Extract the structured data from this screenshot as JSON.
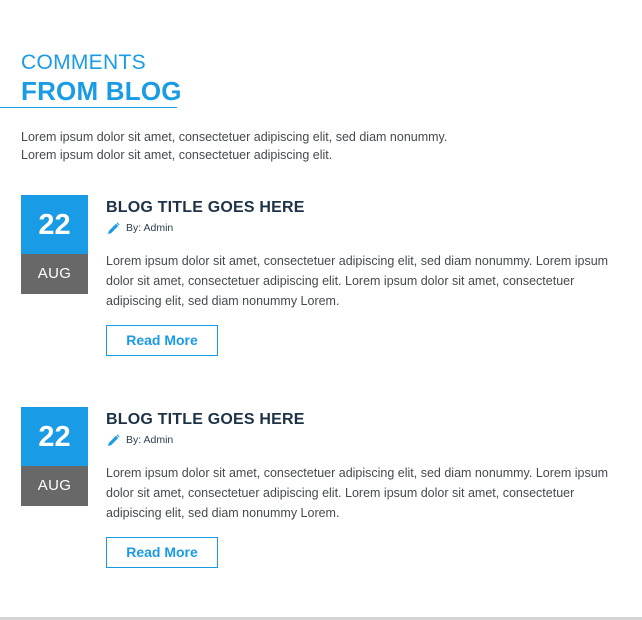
{
  "section": {
    "heading_small": "COMMENTS",
    "heading_large": "FROM BLOG",
    "intro": "Lorem ipsum dolor sit amet, consectetuer adipiscing elit, sed diam nonummy. Lorem ipsum dolor sit amet, consectetuer adipiscing elit.",
    "accent_color": "#1a9be6",
    "month_bg_color": "#686868"
  },
  "posts": [
    {
      "day": "22",
      "month": "AUG",
      "title": "BLOG TITLE GOES HERE",
      "author": "By: Admin",
      "author_icon": "pencil-icon",
      "excerpt": "Lorem ipsum dolor sit amet, consectetuer adipiscing elit, sed diam nonummy. Lorem ipsum dolor sit amet, consectetuer adipiscing elit. Lorem ipsum dolor sit amet, consectetuer adipiscing elit, sed diam nonummy Lorem.",
      "button_label": "Read More"
    },
    {
      "day": "22",
      "month": "AUG",
      "title": "BLOG TITLE GOES HERE",
      "author": "By: Admin",
      "author_icon": "pencil-icon",
      "excerpt": "Lorem ipsum dolor sit amet, consectetuer adipiscing elit, sed diam nonummy. Lorem ipsum dolor sit amet, consectetuer adipiscing elit. Lorem ipsum dolor sit amet, consectetuer adipiscing elit, sed diam nonummy Lorem.",
      "button_label": "Read More"
    }
  ]
}
